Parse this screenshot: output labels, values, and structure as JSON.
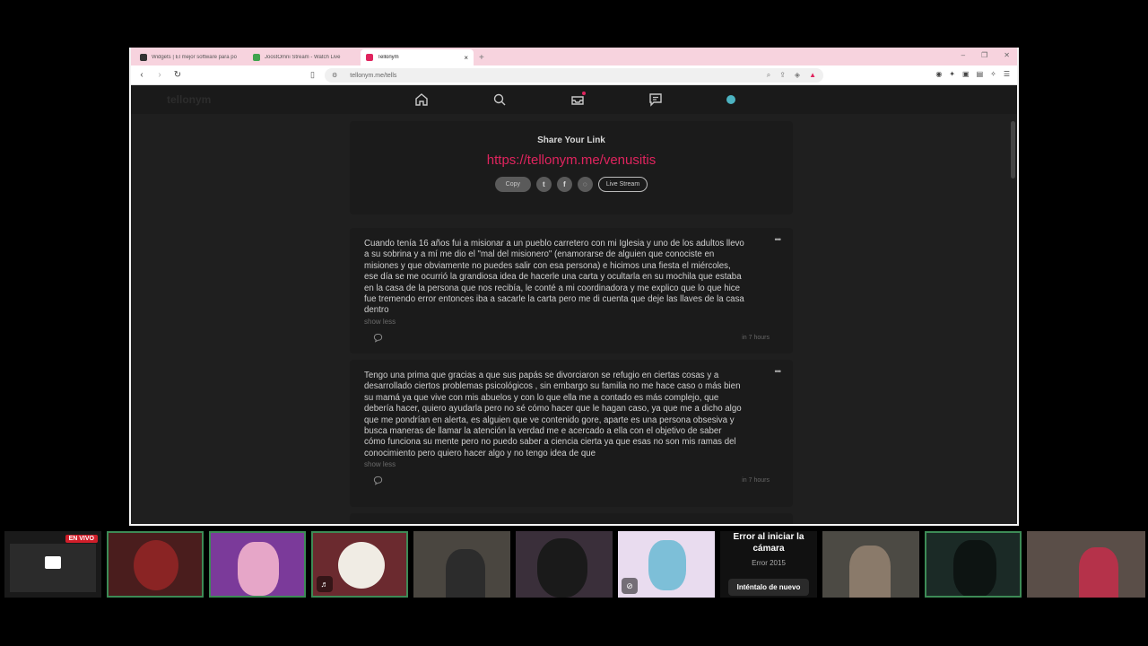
{
  "browser": {
    "tabs": [
      {
        "title": "Widgets | El mejor software para po",
        "favicon_color": "#333333"
      },
      {
        "title": "JoostOmni Stream - Watch Live",
        "favicon_color": "#3fa34d"
      },
      {
        "title": "Tellonym",
        "favicon_color": "#e0245e"
      }
    ],
    "new_tab": "+",
    "url": "tellonym.me/tells"
  },
  "app": {
    "brand": "tellonym"
  },
  "share": {
    "title": "Share Your Link",
    "link": "https://tellonym.me/venusitis",
    "copy_label": "Copy",
    "live_label": "Live Stream"
  },
  "tells": [
    {
      "text": "Cuando tenía 16 años fui a misionar a un pueblo carretero con mi Iglesia y uno de los adultos llevo a su sobrina y a mí me dio el \"mal del misionero\" (enamorarse de alguien que conociste en misiones y que obviamente no puedes salir con esa persona) e hicimos una fiesta el miércoles, ese día se me ocurrió la grandiosa idea de hacerle una carta y ocultarla en su mochila que estaba en la casa de la persona que nos recibía, le conté a mi coordinadora y me explico que lo que hice fue tremendo error entonces iba a sacarle la carta pero me di cuenta que deje las llaves de la casa dentro",
      "show_less": "show less",
      "time": "in 7 hours"
    },
    {
      "text": "Tengo una prima que gracias a que sus papás se divorciaron se refugio en ciertas cosas y a desarrollado ciertos problemas psicológicos , sin embargo su familia no me hace caso o más bien su mamá ya que vive con mis abuelos y con lo que ella me a contado es más complejo, que debería hacer, quiero ayudarla pero no sé cómo hacer que le hagan caso, ya que me a dicho algo que me pondrían en alerta, es alguien que ve contenido gore, aparte es una persona obsesiva y busca maneras de llamar la atención la verdad me e acercado a ella con el objetivo de saber cómo funciona su mente pero no puedo saber a ciencia cierta ya que esas no son mis ramas del conocimiento pero quiero hacer algo y no tengo idea de que",
      "show_less": "show less",
      "time": "in 7 hours"
    }
  ],
  "strip": {
    "live_badge": "EN VIVO",
    "error_title": "Error al iniciar la cámara",
    "error_code": "Error 2015",
    "retry_label": "Inténtalo de nuevo"
  }
}
